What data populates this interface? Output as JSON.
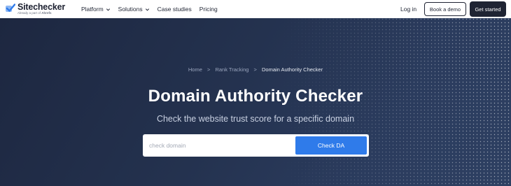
{
  "brand": {
    "name": "Sitechecker",
    "tagline_prefix": "Already a part of",
    "tagline_highlight": "Ahrefs"
  },
  "nav": {
    "items": [
      {
        "label": "Platform",
        "has_dropdown": true
      },
      {
        "label": "Solutions",
        "has_dropdown": true
      },
      {
        "label": "Case studies",
        "has_dropdown": false
      },
      {
        "label": "Pricing",
        "has_dropdown": false
      }
    ],
    "login_label": "Log in",
    "demo_label": "Book a demo",
    "start_label": "Get started"
  },
  "breadcrumb": {
    "items": [
      "Home",
      "Rank Tracking",
      "Domain Authority Checker"
    ],
    "separator": ">"
  },
  "hero": {
    "title": "Domain Authority Checker",
    "subtitle": "Check the website trust score for a specific domain"
  },
  "search": {
    "placeholder": "check domain",
    "value": "",
    "button_label": "Check DA"
  },
  "colors": {
    "brand_blue": "#2f7bea",
    "dark": "#1f2433",
    "hero_bg": "#24324f"
  },
  "icons": [
    "check-logo-icon",
    "chevron-down-icon"
  ]
}
